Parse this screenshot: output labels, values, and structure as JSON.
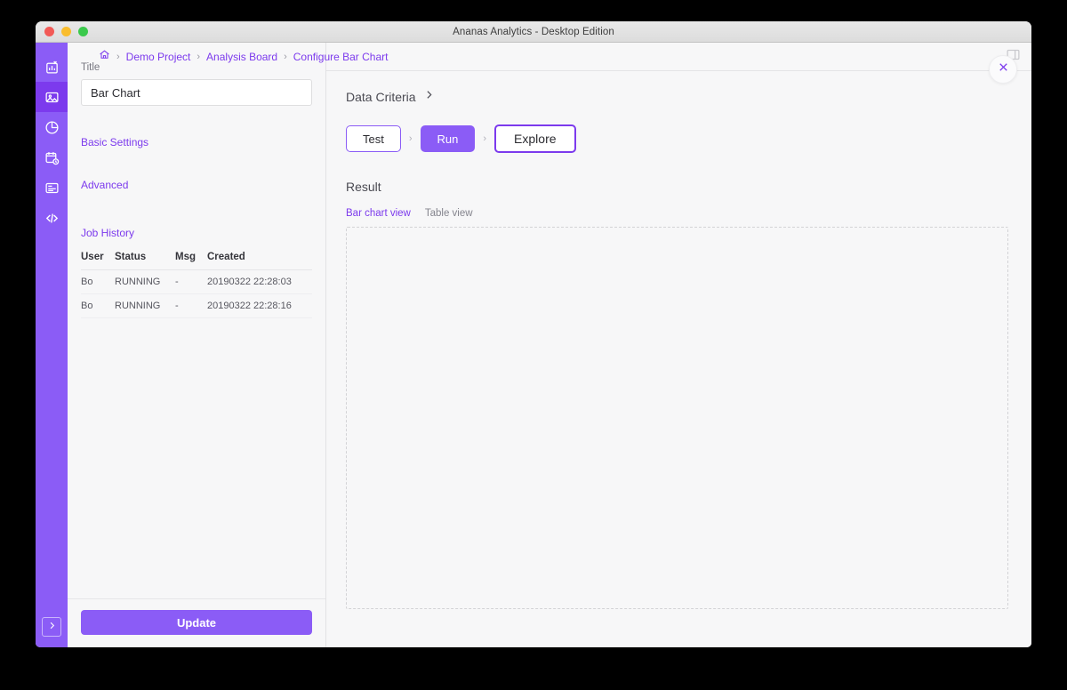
{
  "window": {
    "title": "Ananas Analytics - Desktop Edition",
    "traffic_lights": [
      "close",
      "minimize",
      "zoom"
    ]
  },
  "rail": {
    "items": [
      {
        "icon": "chart-edit-icon",
        "name": "dashboard",
        "active": false
      },
      {
        "icon": "image-edit-icon",
        "name": "analysis",
        "active": true
      },
      {
        "icon": "pie-chart-icon",
        "name": "reports",
        "active": false
      },
      {
        "icon": "calendar-clock-icon",
        "name": "scheduler",
        "active": false
      },
      {
        "icon": "form-list-icon",
        "name": "datasets",
        "active": false
      },
      {
        "icon": "code-icon",
        "name": "developer",
        "active": false
      }
    ],
    "expand_icon": "chevron-right-icon"
  },
  "breadcrumb": {
    "home_icon": "home-icon",
    "separator": "›",
    "items": [
      {
        "label": "Demo Project"
      },
      {
        "label": "Analysis Board"
      },
      {
        "label": "Configure Bar Chart"
      }
    ]
  },
  "topbar": {
    "layout_toggle_icon": "panel-layout-icon"
  },
  "left_panel": {
    "title_field": {
      "label": "Title",
      "value": "Bar Chart",
      "placeholder": "Title"
    },
    "sections": [
      {
        "label": "Basic Settings"
      },
      {
        "label": "Advanced"
      }
    ],
    "job_history": {
      "label": "Job History",
      "columns": [
        "User",
        "Status",
        "Msg",
        "Created"
      ],
      "rows": [
        {
          "user": "Bo",
          "status": "RUNNING",
          "msg": "-",
          "created": "20190322 22:28:03"
        },
        {
          "user": "Bo",
          "status": "RUNNING",
          "msg": "-",
          "created": "20190322 22:28:16"
        }
      ]
    },
    "update_button": "Update"
  },
  "right_panel": {
    "criteria": {
      "label": "Data Criteria",
      "expand_icon": "chevron-right-icon"
    },
    "steps": [
      {
        "label": "Test",
        "style": "outline"
      },
      {
        "label": "Run",
        "style": "filled"
      },
      {
        "label": "Explore",
        "style": "emphasis"
      }
    ],
    "step_separator": "›",
    "result": {
      "label": "Result",
      "tabs": [
        {
          "label": "Bar chart view",
          "active": true
        },
        {
          "label": "Table view",
          "active": false
        }
      ],
      "canvas_content": ""
    },
    "close_icon": "close-icon"
  },
  "colors": {
    "accent": "#8b5cf6",
    "accent_dark": "#7c3aed",
    "panel_bg": "#f7f7f8",
    "border": "#e2e2e4"
  }
}
